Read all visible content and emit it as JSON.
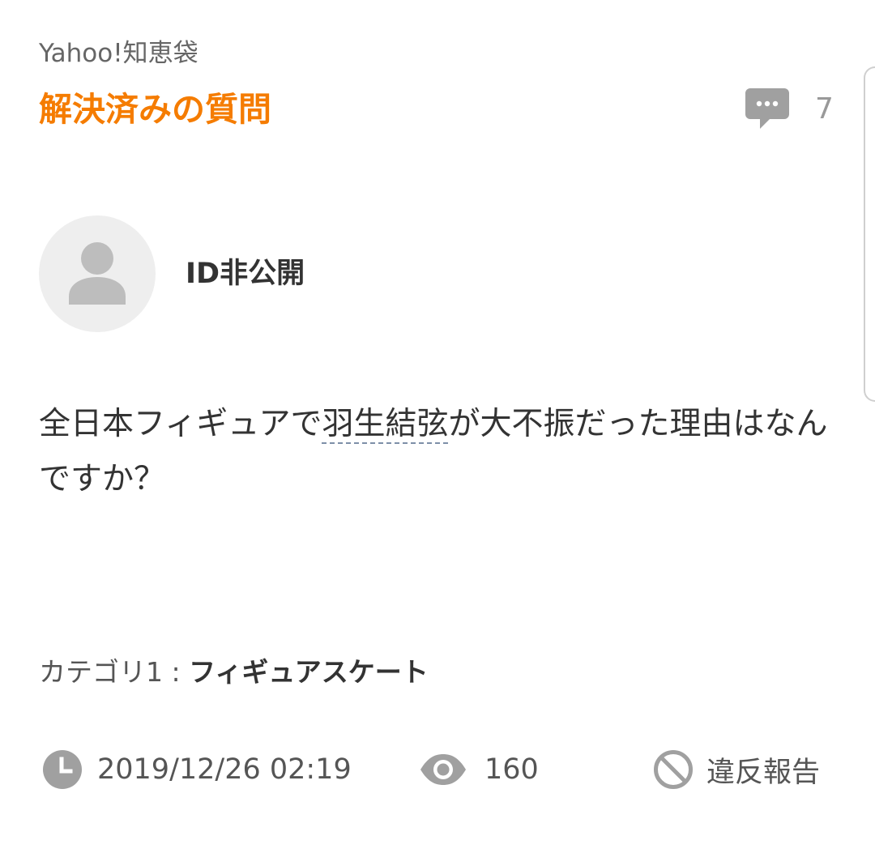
{
  "header": {
    "site_name": "Yahoo!知恵袋",
    "section_title": "解決済みの質問",
    "comment_icon": "speech-bubble-icon",
    "comment_count": "7"
  },
  "questioner": {
    "avatar_icon": "default-user-avatar-icon",
    "name": "ID非公開"
  },
  "question": {
    "text_before": "全日本フィギュアで",
    "keyword": "羽生結弦",
    "text_after": "が大不振だった理由はなんですか？"
  },
  "category": {
    "label": "カテゴリ1 : ",
    "value": "フィギュアスケート"
  },
  "meta": {
    "clock_icon": "clock-icon",
    "posted_at": "2019/12/26 02:19",
    "views_icon": "eye-icon",
    "view_count": "160",
    "report_icon": "prohibited-icon",
    "report_label": "違反報告"
  },
  "colors": {
    "accent": "#f57c00",
    "icon_gray": "#a0a0a0",
    "text": "#333333"
  }
}
